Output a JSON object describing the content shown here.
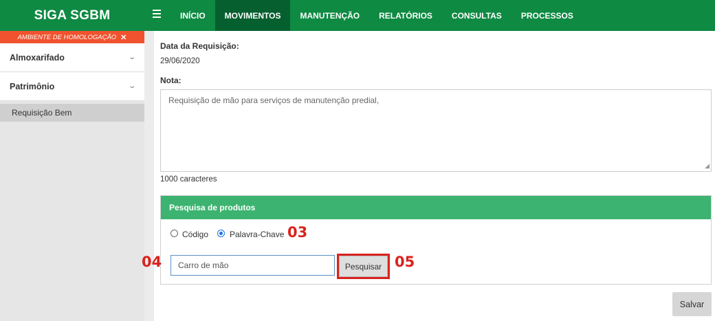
{
  "header": {
    "brand": "SIGA SGBM",
    "menu": [
      {
        "label": "INÍCIO"
      },
      {
        "label": "MOVIMENTOS"
      },
      {
        "label": "MANUTENÇÃO"
      },
      {
        "label": "RELATÓRIOS"
      },
      {
        "label": "CONSULTAS"
      },
      {
        "label": "PROCESSOS"
      }
    ],
    "active_menu": "MOVIMENTOS"
  },
  "sidebar": {
    "environment_banner": "AMBIENTE DE HOMOLOGAÇÃO",
    "sections": [
      {
        "label": "Almoxarifado"
      },
      {
        "label": "Patrimônio"
      }
    ],
    "sub_items": [
      {
        "label": "Requisição Bem"
      }
    ]
  },
  "form": {
    "date_label": "Data da Requisição:",
    "date_value": "29/06/2020",
    "note_label": "Nota:",
    "note_value": "Requisição de mão para serviços de manutenção predial,",
    "char_count": "1000 caracteres"
  },
  "search_panel": {
    "title": "Pesquisa de produtos",
    "options": [
      {
        "label": "Código",
        "checked": false
      },
      {
        "label": "Palavra-Chave",
        "checked": true
      }
    ],
    "input_value": "Carro de mão",
    "button_label": "Pesquisar"
  },
  "annotations": {
    "a03": "03",
    "a04": "04",
    "a05": "05"
  },
  "actions": {
    "save_label": "Salvar"
  },
  "colors": {
    "header_bg": "#0e8a43",
    "active_menu_bg": "#065f2e",
    "environment_banner": "#f0522f",
    "panel_header": "#3cb371",
    "annotation_red": "#d9231f"
  }
}
